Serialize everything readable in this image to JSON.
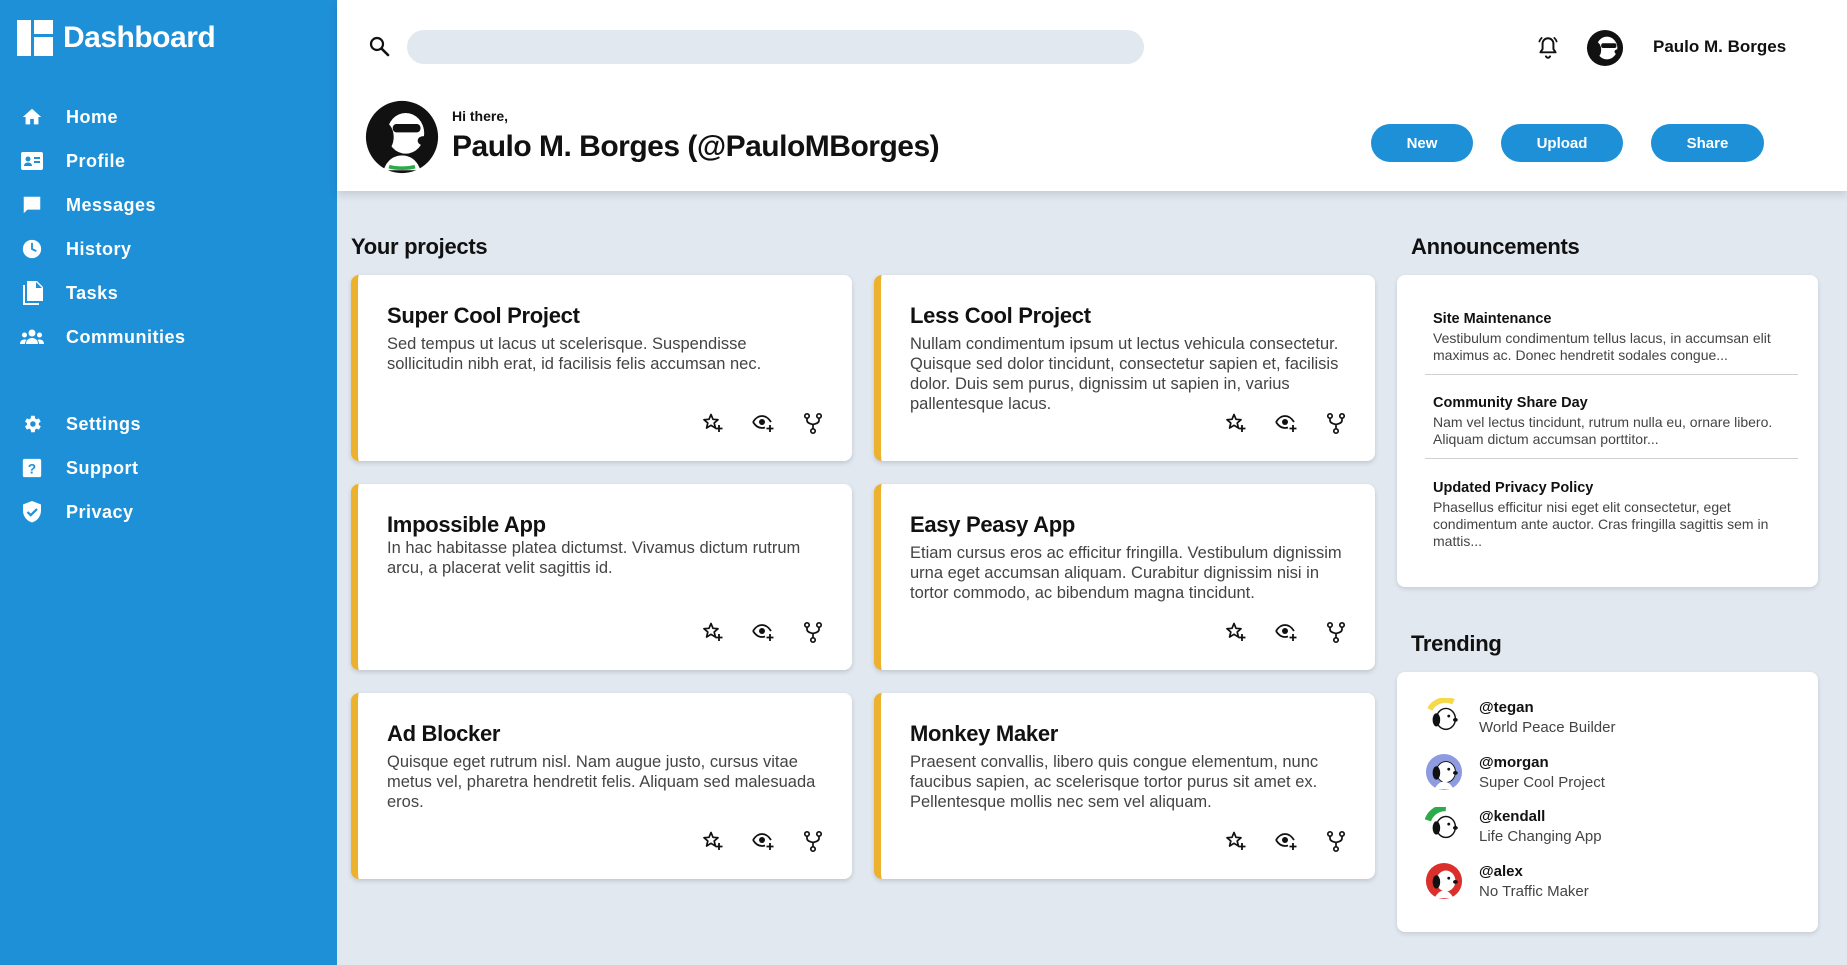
{
  "app": {
    "title": "Dashboard"
  },
  "sidebar": {
    "items": [
      {
        "label": "Home",
        "icon": "home-icon"
      },
      {
        "label": "Profile",
        "icon": "profile-card-icon"
      },
      {
        "label": "Messages",
        "icon": "message-icon"
      },
      {
        "label": "History",
        "icon": "clock-icon"
      },
      {
        "label": "Tasks",
        "icon": "document-icon"
      },
      {
        "label": "Communities",
        "icon": "people-icon"
      },
      {
        "label": "Settings",
        "icon": "gear-icon"
      },
      {
        "label": "Support",
        "icon": "question-icon"
      },
      {
        "label": "Privacy",
        "icon": "shield-icon"
      }
    ]
  },
  "header": {
    "search": {
      "placeholder": "",
      "value": ""
    },
    "username": "Paulo M. Borges",
    "greeting": "Hi there,",
    "title": "Paulo M. Borges (@PauloMBorges)",
    "buttons": {
      "new": "New",
      "upload": "Upload",
      "share": "Share"
    }
  },
  "projects": {
    "heading": "Your projects",
    "items": [
      {
        "title": "Super Cool Project",
        "description": "Sed tempus ut lacus ut scelerisque. Suspendisse sollicitudin nibh erat, id facilisis felis accumsan nec."
      },
      {
        "title": "Less Cool Project",
        "description": "Nullam condimentum ipsum ut lectus vehicula consectetur. Quisque sed dolor tincidunt, consectetur sapien et, facilisis dolor. Duis sem purus, dignissim ut sapien in, varius pallentesque lacus."
      },
      {
        "title": "Impossible App",
        "description": "In hac habitasse platea dictumst. Vivamus dictum rutrum arcu, a placerat velit sagittis id."
      },
      {
        "title": "Easy Peasy App",
        "description": "Etiam cursus eros ac efficitur fringilla. Vestibulum dignissim urna eget accumsan aliquam. Curabitur dignissim nisi in tortor commodo, ac bibendum magna tincidunt."
      },
      {
        "title": "Ad Blocker",
        "description": "Quisque eget rutrum nisl. Nam augue justo, cursus vitae metus vel, pharetra hendretit felis. Aliquam sed malesuada eros."
      },
      {
        "title": "Monkey Maker",
        "description": "Praesent convallis, libero quis congue elementum, nunc faucibus sapien, ac scelerisque tortor purus sit amet ex. Pellentesque mollis nec sem vel aliquam."
      }
    ],
    "actions": [
      "star-add-icon",
      "watch-eye-icon",
      "fork-icon"
    ]
  },
  "announcements": {
    "heading": "Announcements",
    "items": [
      {
        "title": "Site Maintenance",
        "text": "Vestibulum condimentum tellus lacus, in accumsan elit maximus ac. Donec hendretit sodales congue..."
      },
      {
        "title": "Community Share Day",
        "text": "Nam vel lectus tincidunt, rutrum nulla eu, ornare libero. Aliquam dictum accumsan porttitor..."
      },
      {
        "title": "Updated Privacy Policy",
        "text": "Phasellus efficitur nisi eget elit consectetur, eget condimentum ante auctor. Cras fringilla sagittis sem in mattis..."
      }
    ]
  },
  "trending": {
    "heading": "Trending",
    "items": [
      {
        "handle": "@tegan",
        "project": "World Peace Builder",
        "color": "#f5d94a"
      },
      {
        "handle": "@morgan",
        "project": "Super Cool Project",
        "color": "#8e9be0"
      },
      {
        "handle": "@kendall",
        "project": "Life Changing App",
        "color": "#2eaa4a"
      },
      {
        "handle": "@alex",
        "project": "No Traffic Maker",
        "color": "#d9302c"
      }
    ]
  },
  "colors": {
    "primary": "#1e90d8",
    "accent": "#ecb22e",
    "background": "#e2e8f0"
  }
}
